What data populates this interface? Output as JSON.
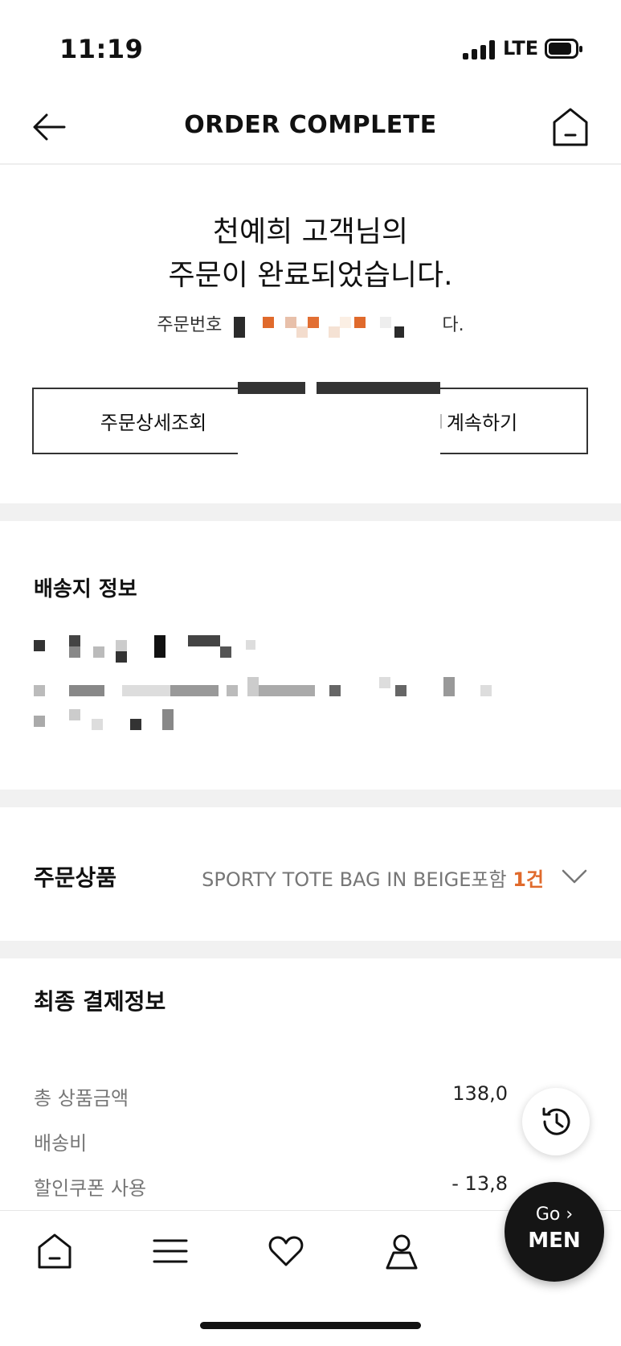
{
  "status_bar": {
    "time": "11:19",
    "network": "LTE"
  },
  "header": {
    "title": "ORDER COMPLETE"
  },
  "complete": {
    "line1": "천예희 고객님의",
    "line2": "주문이 완료되었습니다.",
    "order_number_label": "주문번호",
    "order_number_suffix": "다."
  },
  "buttons": {
    "detail": "주문상세조회",
    "continue": "계속하기"
  },
  "shipping": {
    "title": "배송지 정보"
  },
  "products": {
    "label": "주문상품",
    "summary": "SPORTY TOTE BAG IN BEIGE포함",
    "count": "1건"
  },
  "payment": {
    "title": "최종 결제정보",
    "rows": [
      {
        "label": "총 상품금액",
        "value": "138,0"
      },
      {
        "label": "배송비",
        "value": ""
      },
      {
        "label": "할인쿠폰 사용",
        "value": "- 13,8"
      }
    ]
  },
  "fab": {
    "go": "Go ›",
    "men": "MEN"
  },
  "icons": {
    "back": "arrow-left-icon",
    "home": "home-icon",
    "chevron": "chevron-down-icon",
    "history": "history-icon",
    "menu": "menu-icon",
    "wishlist": "heart-icon",
    "account": "user-icon"
  },
  "colors": {
    "accent": "#e06a2c",
    "fab_bg": "#151515",
    "text": "#111111",
    "divider": "#f1f1f1"
  }
}
